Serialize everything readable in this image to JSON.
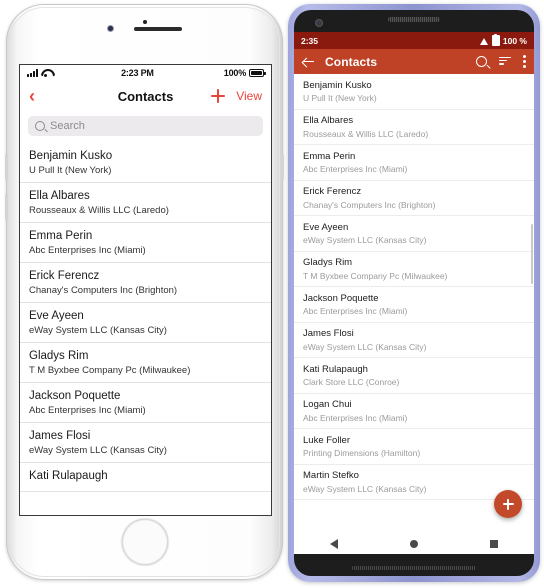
{
  "ios": {
    "status": {
      "time": "2:23 PM",
      "battery": "100%",
      "signal_icon": "cellular-bars-icon",
      "wifi_icon": "wifi-icon",
      "battery_icon": "battery-icon"
    },
    "nav": {
      "back_icon": "chevron-left-icon",
      "title": "Contacts",
      "add_icon": "plus-icon",
      "view_label": "View"
    },
    "search": {
      "placeholder": "Search",
      "icon": "search-icon"
    },
    "contacts": [
      {
        "name": "Benjamin Kusko",
        "company": "U Pull It (New York)"
      },
      {
        "name": "Ella Albares",
        "company": "Rousseaux & Willis LLC (Laredo)"
      },
      {
        "name": "Emma Perin",
        "company": "Abc Enterprises Inc (Miami)"
      },
      {
        "name": "Erick Ferencz",
        "company": "Chanay's Computers Inc (Brighton)"
      },
      {
        "name": "Eve Ayeen",
        "company": "eWay System LLC (Kansas City)"
      },
      {
        "name": "Gladys Rim",
        "company": "T M Byxbee Company Pc (Milwaukee)"
      },
      {
        "name": "Jackson Poquette",
        "company": "Abc Enterprises Inc (Miami)"
      },
      {
        "name": "James Flosi",
        "company": "eWay System LLC (Kansas City)"
      },
      {
        "name": "Kati Rulapaugh",
        "company": ""
      }
    ]
  },
  "android": {
    "status": {
      "time": "2:35",
      "battery": "100 %",
      "wifi_icon": "wifi-icon",
      "battery_icon": "battery-icon"
    },
    "toolbar": {
      "back_icon": "arrow-back-icon",
      "title": "Contacts",
      "search_icon": "search-icon",
      "sort_icon": "sort-icon",
      "overflow_icon": "more-vertical-icon"
    },
    "fab": {
      "icon": "plus-icon",
      "label": "+"
    },
    "navbar": {
      "back_icon": "nav-back-triangle-icon",
      "home_icon": "nav-home-circle-icon",
      "recents_icon": "nav-recents-square-icon"
    },
    "contacts": [
      {
        "name": "Benjamin Kusko",
        "company": "U Pull It (New York)"
      },
      {
        "name": "Ella Albares",
        "company": "Rousseaux & Willis LLC (Laredo)"
      },
      {
        "name": "Emma Perin",
        "company": "Abc Enterprises Inc (Miami)"
      },
      {
        "name": "Erick Ferencz",
        "company": "Chanay's Computers Inc (Brighton)"
      },
      {
        "name": "Eve Ayeen",
        "company": "eWay System LLC (Kansas City)"
      },
      {
        "name": "Gladys Rim",
        "company": "T M Byxbee Company Pc (Milwaukee)"
      },
      {
        "name": "Jackson Poquette",
        "company": "Abc Enterprises Inc (Miami)"
      },
      {
        "name": "James Flosi",
        "company": "eWay System LLC (Kansas City)"
      },
      {
        "name": "Kati Rulapaugh",
        "company": "Clark Store LLC (Conroe)"
      },
      {
        "name": "Logan Chui",
        "company": "Abc Enterprises Inc (Miami)"
      },
      {
        "name": "Luke Foller",
        "company": "Printing Dimensions (Hamilton)"
      },
      {
        "name": "Martin Stefko",
        "company": "eWay System LLC (Kansas City)"
      }
    ]
  },
  "colors": {
    "ios_accent": "#e8453c",
    "android_statusbar": "#8b1a0e",
    "android_toolbar": "#bf4226",
    "android_fab": "#c24a2b",
    "android_frame": "#9499d4"
  }
}
